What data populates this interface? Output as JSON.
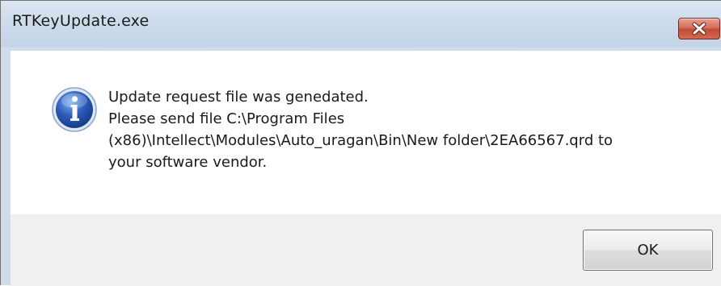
{
  "window": {
    "title": "RTKeyUpdate.exe"
  },
  "message": {
    "icon": "info-icon",
    "lines": [
      "Update request file was genedated.",
      "Please send file C:\\Program Files",
      "(x86)\\Intellect\\Modules\\Auto_uragan\\Bin\\New folder\\2EA66567.qrd to",
      "your software vendor."
    ]
  },
  "buttons": {
    "ok_label": "OK",
    "close_icon": "close-icon"
  },
  "colors": {
    "close_button": "#c94f38",
    "info_icon": "#2a5bb8"
  }
}
